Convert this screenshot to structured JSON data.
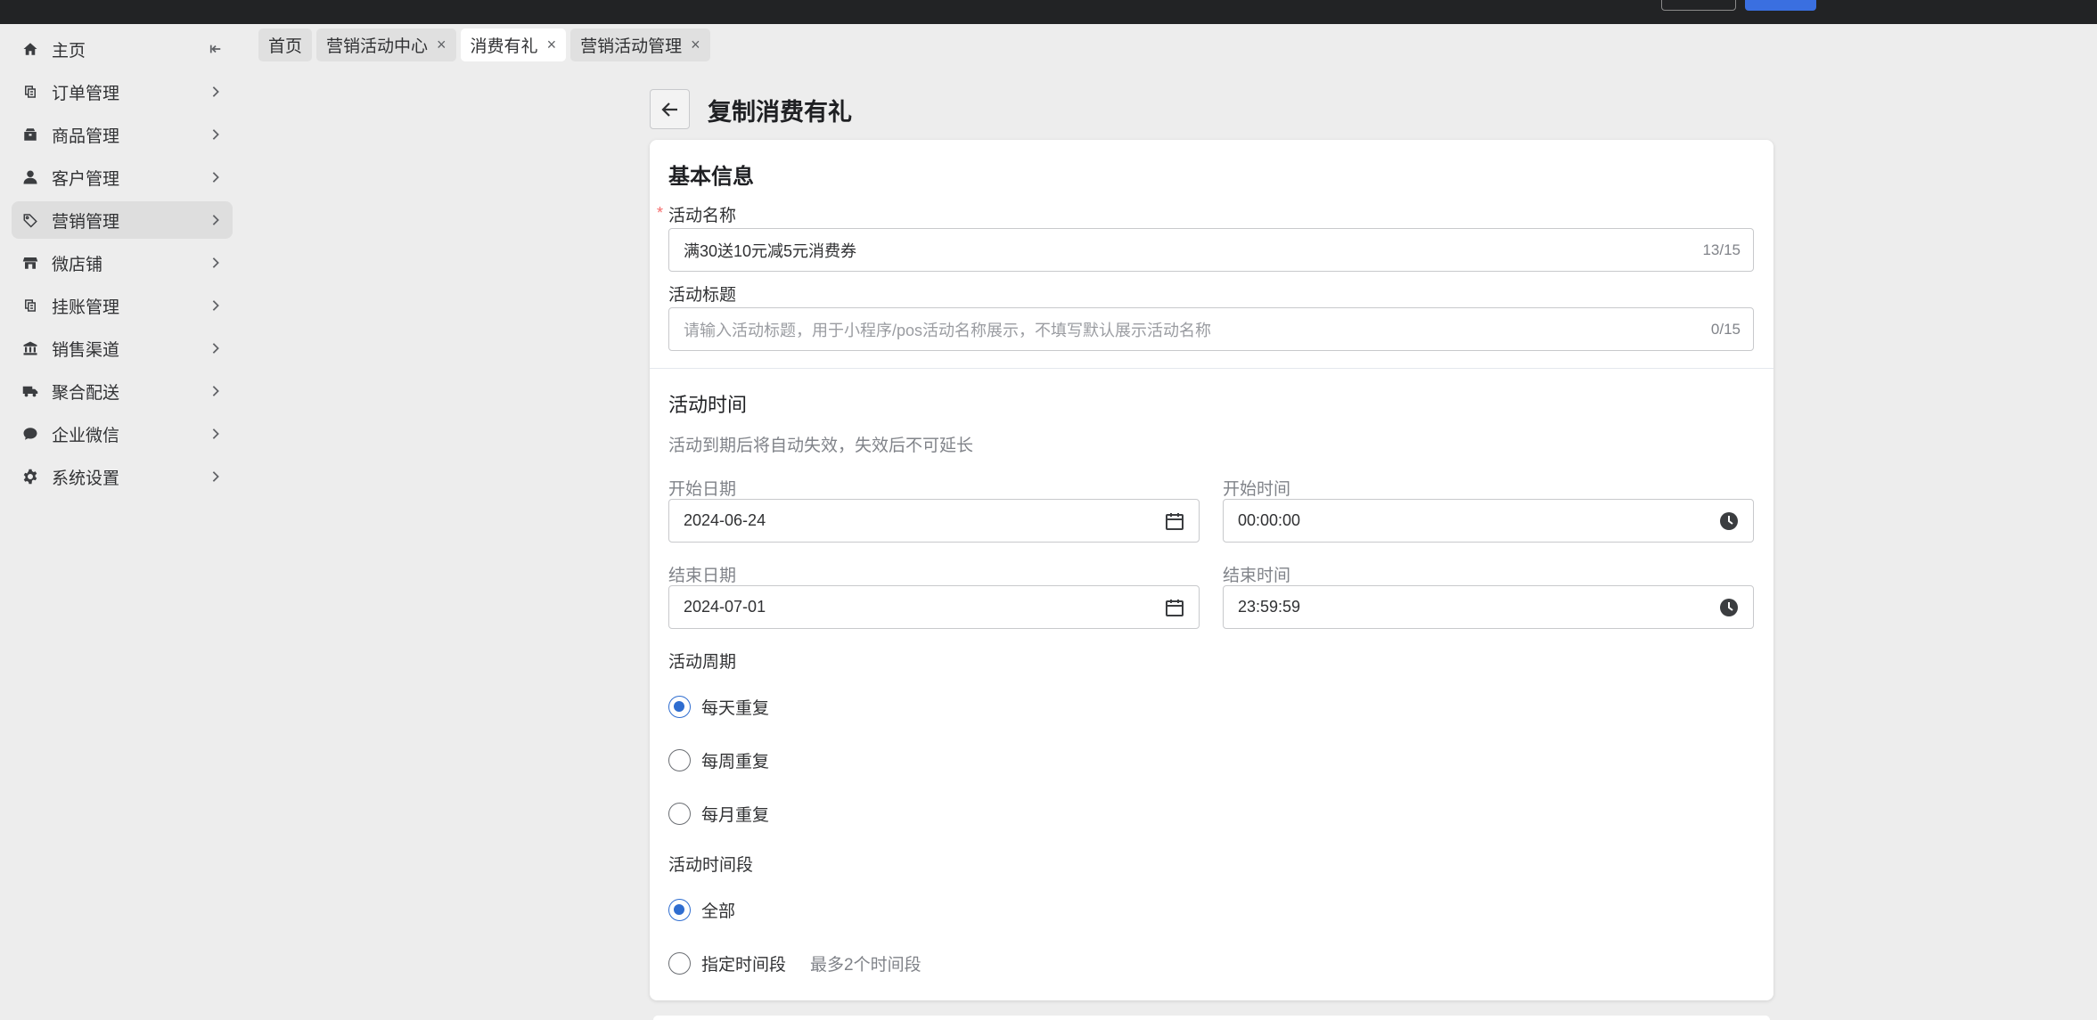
{
  "sidebar": {
    "items": [
      {
        "label": "主页",
        "icon": "home-icon"
      },
      {
        "label": "订单管理",
        "icon": "order-icon"
      },
      {
        "label": "商品管理",
        "icon": "product-icon"
      },
      {
        "label": "客户管理",
        "icon": "user-icon"
      },
      {
        "label": "营销管理",
        "icon": "tag-icon"
      },
      {
        "label": "微店铺",
        "icon": "store-icon"
      },
      {
        "label": "挂账管理",
        "icon": "ledger-icon"
      },
      {
        "label": "销售渠道",
        "icon": "bank-icon"
      },
      {
        "label": "聚合配送",
        "icon": "truck-icon"
      },
      {
        "label": "企业微信",
        "icon": "chat-icon"
      },
      {
        "label": "系统设置",
        "icon": "gear-icon"
      }
    ],
    "active_item": "营销管理"
  },
  "tabs": [
    {
      "label": "首页",
      "closable": false,
      "active": false
    },
    {
      "label": "营销活动中心",
      "closable": true,
      "active": false
    },
    {
      "label": "消费有礼",
      "closable": true,
      "active": true
    },
    {
      "label": "营销活动管理",
      "closable": true,
      "active": false
    }
  ],
  "header": {
    "title": "复制消费有礼"
  },
  "basic": {
    "section_title": "基本信息",
    "name_label": "活动名称",
    "name_value": "满30送10元减5元消费券",
    "name_count": "13/15",
    "title_label": "活动标题",
    "title_placeholder": "请输入活动标题，用于小程序/pos活动名称展示，不填写默认展示活动名称",
    "title_count": "0/15"
  },
  "time": {
    "section_title": "活动时间",
    "hint": "活动到期后将自动失效，失效后不可延长",
    "start_date_label": "开始日期",
    "start_date": "2024-06-24",
    "start_time_label": "开始时间",
    "start_time": "00:00:00",
    "end_date_label": "结束日期",
    "end_date": "2024-07-01",
    "end_time_label": "结束时间",
    "end_time": "23:59:59",
    "cycle_label": "活动周期",
    "cycle_options": [
      "每天重复",
      "每周重复",
      "每月重复"
    ],
    "cycle_selected": "每天重复",
    "period_label": "活动时间段",
    "period_options": [
      "全部",
      "指定时间段"
    ],
    "period_selected": "全部",
    "period_extra": "最多2个时间段"
  },
  "colors": {
    "primary": "#2f6dd0",
    "required": "#f56c6c",
    "topbar": "#222325"
  }
}
